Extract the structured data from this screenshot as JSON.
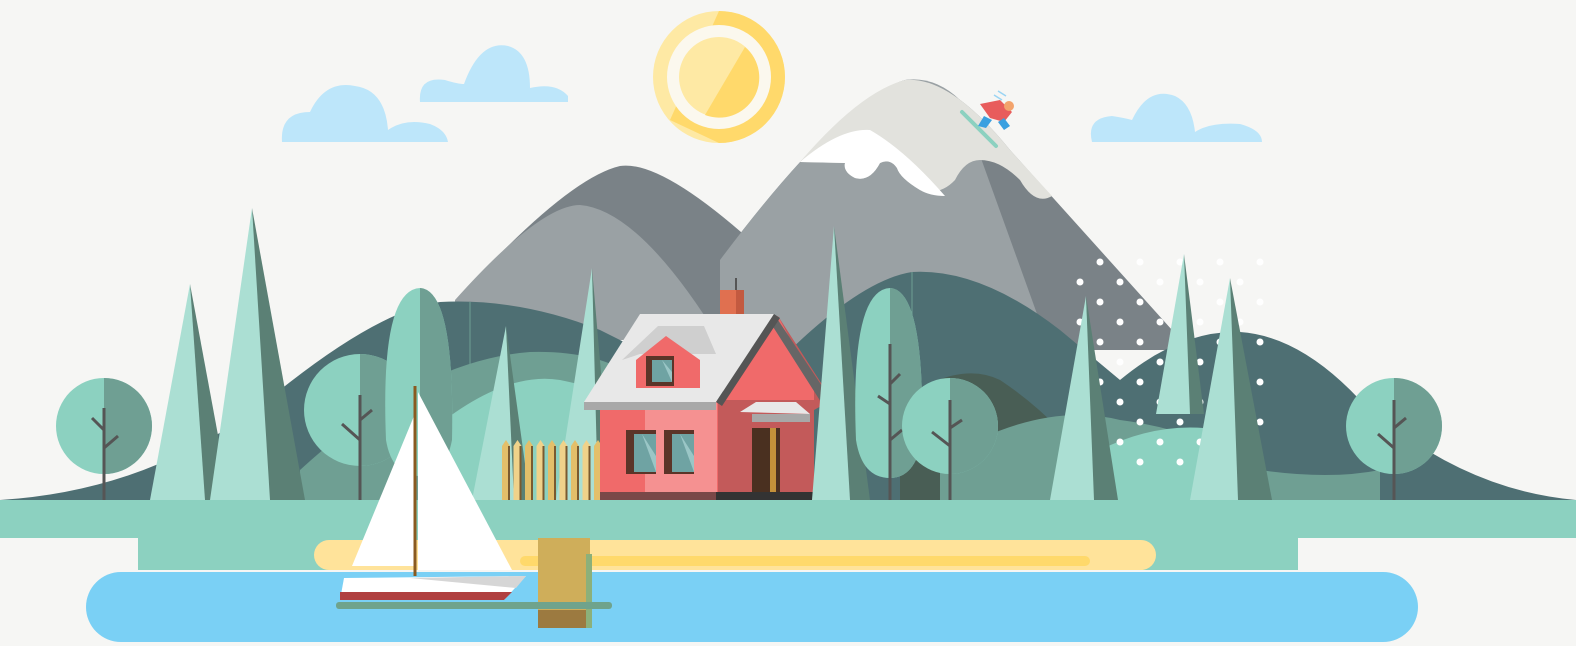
{
  "scene": {
    "kind": "flat-illustration",
    "elements": [
      "sun",
      "clouds",
      "snow-capped-mountain",
      "skier",
      "hills",
      "pine-trees",
      "round-trees",
      "house",
      "fence",
      "sailboat",
      "pier",
      "lake",
      "beach",
      "snowfall"
    ],
    "colors": {
      "background": "#f6f6f4",
      "sun": "#ffd96b",
      "sun_ring": "#fee9a4",
      "cloud": "#bde6fa",
      "mountain_dark": "#7a8287",
      "mountain_light": "#9aa1a4",
      "snow": "#e2e2dd",
      "hill_dark": "#4e6f73",
      "hill_mid": "#6f9f93",
      "tree_light": "#abdfd3",
      "tree_shade": "#5b8075",
      "grass": "#8cd1c0",
      "house_wall": "#f06a6a",
      "house_shade": "#c35a5a",
      "roof": "#e8e8e8",
      "water": "#7ad0f5",
      "sand": "#ffe39a",
      "fence": "#f0d28a",
      "pier": "#cfae5a"
    }
  }
}
